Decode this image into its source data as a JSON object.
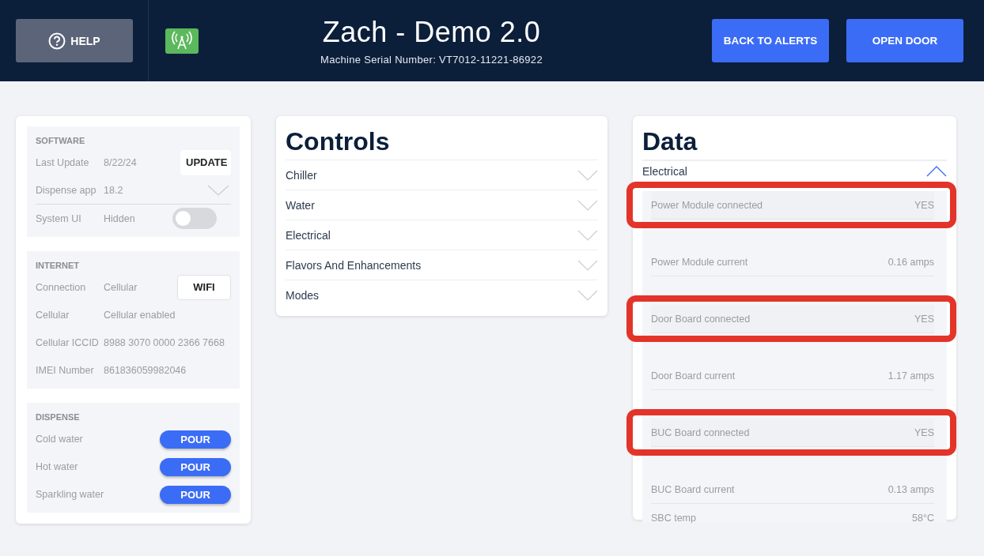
{
  "header": {
    "help_label": "HELP",
    "title": "Zach - Demo 2.0",
    "serial": "Machine Serial Number: VT7012-11221-86922",
    "buttons": [
      "BACK TO ALERTS",
      "OPEN DOOR"
    ]
  },
  "software": {
    "heading": "SOFTWARE",
    "rows": [
      {
        "kind": "button",
        "label": "Last Update",
        "value": "8/22/24",
        "action": "UPDATE"
      },
      {
        "kind": "dropdown",
        "label": "Dispense app",
        "value": "18.2",
        "expanded": false
      },
      {
        "kind": "toggle",
        "label": "System UI",
        "value": "Hidden",
        "on": false
      }
    ]
  },
  "internet": {
    "heading": "INTERNET",
    "rows": [
      {
        "kind": "button",
        "label": "Connection",
        "value": "Cellular",
        "action": "WIFI"
      },
      {
        "kind": "text",
        "label": "Cellular",
        "value": "Cellular enabled"
      },
      {
        "kind": "text",
        "label": "Cellular ICCID",
        "value": "8988 3070 0000 2366 7668"
      },
      {
        "kind": "text",
        "label": "IMEI Number",
        "value": "861836059982046"
      }
    ]
  },
  "dispense": {
    "heading": "DISPENSE",
    "rows": [
      {
        "label": "Cold water",
        "action": "POUR"
      },
      {
        "label": "Hot water",
        "action": "POUR"
      },
      {
        "label": "Sparkling water",
        "action": "POUR"
      }
    ]
  },
  "controls": {
    "title": "Controls",
    "items": [
      {
        "label": "Chiller",
        "expanded": false
      },
      {
        "label": "Water",
        "expanded": false
      },
      {
        "label": "Electrical",
        "expanded": false
      },
      {
        "label": "Flavors And Enhancements",
        "expanded": false
      },
      {
        "label": "Modes",
        "expanded": false
      }
    ]
  },
  "data": {
    "title": "Data",
    "section": {
      "label": "Electrical",
      "expanded": true
    },
    "rows": [
      {
        "kind": "circled",
        "label": "Power Module connected",
        "value": "YES"
      },
      {
        "kind": "plain",
        "label": "Power Module current",
        "value": "0.16 amps"
      },
      {
        "kind": "circled",
        "label": "Door Board connected",
        "value": "YES"
      },
      {
        "kind": "plain",
        "label": "Door Board current",
        "value": "1.17 amps"
      },
      {
        "kind": "circled",
        "label": "BUC Board connected",
        "value": "YES"
      },
      {
        "kind": "plain",
        "label": "BUC Board current",
        "value": "0.13 amps"
      },
      {
        "kind": "plain",
        "label": "SBC temp",
        "value": "58°C"
      }
    ]
  }
}
